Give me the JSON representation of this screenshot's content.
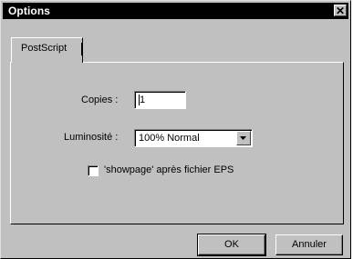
{
  "window": {
    "title": "Options",
    "close_glyph": "✕"
  },
  "tabs": [
    {
      "label": "PostScript"
    }
  ],
  "form": {
    "copies_label": "Copies :",
    "copies_value": "1",
    "luminosity_label": "Luminosité :",
    "luminosity_value": "100% Normal",
    "showpage_label": "'showpage' après fichier EPS",
    "showpage_checked": false
  },
  "buttons": {
    "ok_label": "OK",
    "cancel_label": "Annuler"
  },
  "icons": {
    "close": "close-icon",
    "dropdown": "chevron-down-icon"
  }
}
